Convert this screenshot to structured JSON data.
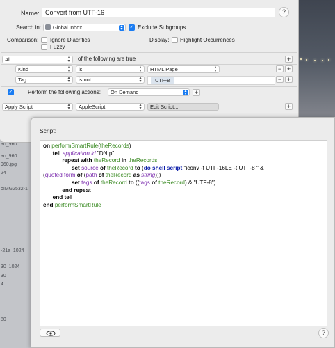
{
  "rule": {
    "name_label": "Name:",
    "name_value": "Convert from UTF-16",
    "search_in_label": "Search in:",
    "search_in_value": "Global Inbox",
    "exclude_subgroups_label": "Exclude Subgroups",
    "exclude_subgroups_checked": true,
    "comparison_label": "Comparison:",
    "ignore_diacritics_label": "Ignore Diacritics",
    "fuzzy_label": "Fuzzy",
    "display_label": "Display:",
    "highlight_label": "Highlight Occurrences",
    "match_value": "All",
    "match_suffix": "of the following are true",
    "conditions": [
      {
        "field": "Kind",
        "operator": "is",
        "value": "HTML Page"
      },
      {
        "field": "Tag",
        "operator": "is not",
        "value": "UTF-8"
      }
    ],
    "perform_label": "Perform the following actions:",
    "perform_value": "On Demand",
    "action": {
      "type": "Apply Script",
      "language": "AppleScript",
      "edit_label": "Edit Script..."
    }
  },
  "script_sheet": {
    "label": "Script:",
    "help": "?"
  },
  "background_items": [
    "an_960",
    "an_960",
    "960.jpg",
    "24",
    "oIMG2532-1",
    "-21a_1024",
    "30_1024",
    "30",
    "4",
    "80"
  ],
  "colors": {
    "accent": "#1a7cf2",
    "handler": "#3a8a22",
    "command": "#0a1ca8",
    "class": "#7b2cae"
  },
  "icons": {
    "help": "question-mark-icon",
    "plus": "plus-icon",
    "minus": "minus-icon",
    "eye": "eye-icon",
    "inbox": "inbox-icon"
  }
}
